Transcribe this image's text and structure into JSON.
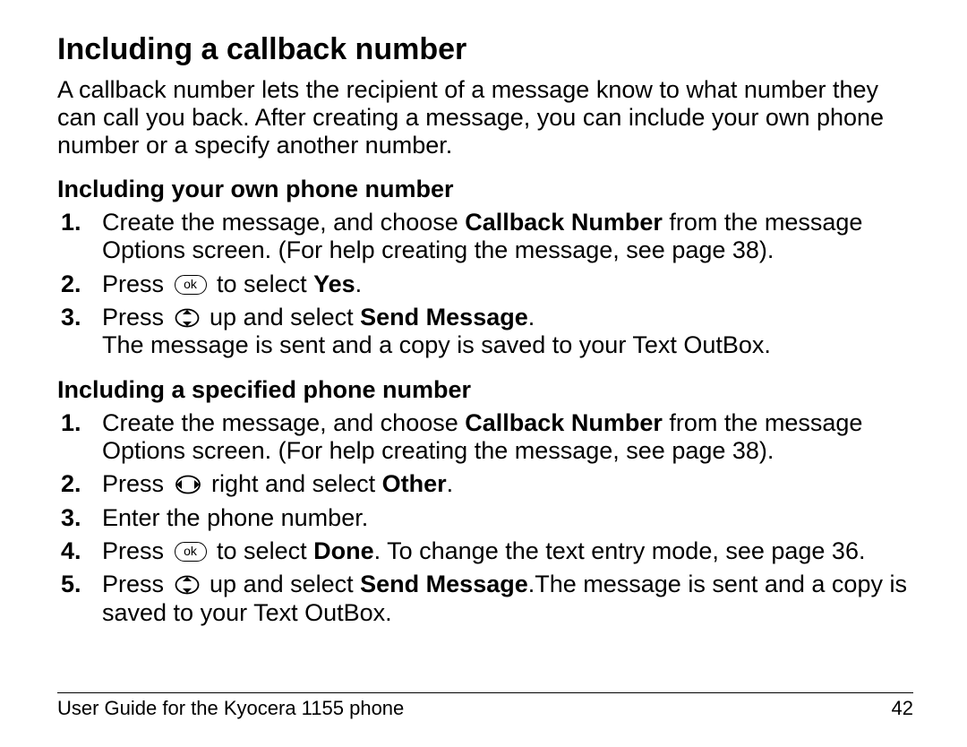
{
  "h1": "Including a callback number",
  "intro": "A callback number lets the recipient of a message know to what number they can call you back. After creating a message, you can include your own phone number or a specify another number.",
  "sec1": {
    "heading": "Including your own phone number",
    "items": {
      "n1": "1.",
      "t1a": "Create the message, and choose ",
      "t1b": "Callback Number",
      "t1c": " from the message Options screen. (For help creating the message, see page 38).",
      "n2": "2.",
      "t2a": "Press ",
      "t2b": " to select ",
      "t2c": "Yes",
      "t2d": ".",
      "n3": "3.",
      "t3a": "Press ",
      "t3b": " up and select ",
      "t3c": "Send Message",
      "t3d": ".",
      "t3e": "The message is sent and a copy is saved to your Text OutBox."
    }
  },
  "sec2": {
    "heading": "Including a specified phone number",
    "items": {
      "n1": "1.",
      "t1a": "Create the message, and choose ",
      "t1b": "Callback Number",
      "t1c": " from the message Options screen. (For help creating the message, see page 38).",
      "n2": "2.",
      "t2a": "Press ",
      "t2b": " right and select ",
      "t2c": "Other",
      "t2d": ".",
      "n3": "3.",
      "t3": "Enter the phone number.",
      "n4": "4.",
      "t4a": "Press ",
      "t4b": " to select ",
      "t4c": "Done",
      "t4d": ". To change the text entry mode, see page 36.",
      "n5": "5.",
      "t5a": "Press ",
      "t5b": " up and select ",
      "t5c": "Send Message",
      "t5d": ".The message is sent and a copy is saved to your Text OutBox."
    }
  },
  "footer": {
    "left": "User Guide for the Kyocera 1155 phone",
    "right": "42"
  }
}
